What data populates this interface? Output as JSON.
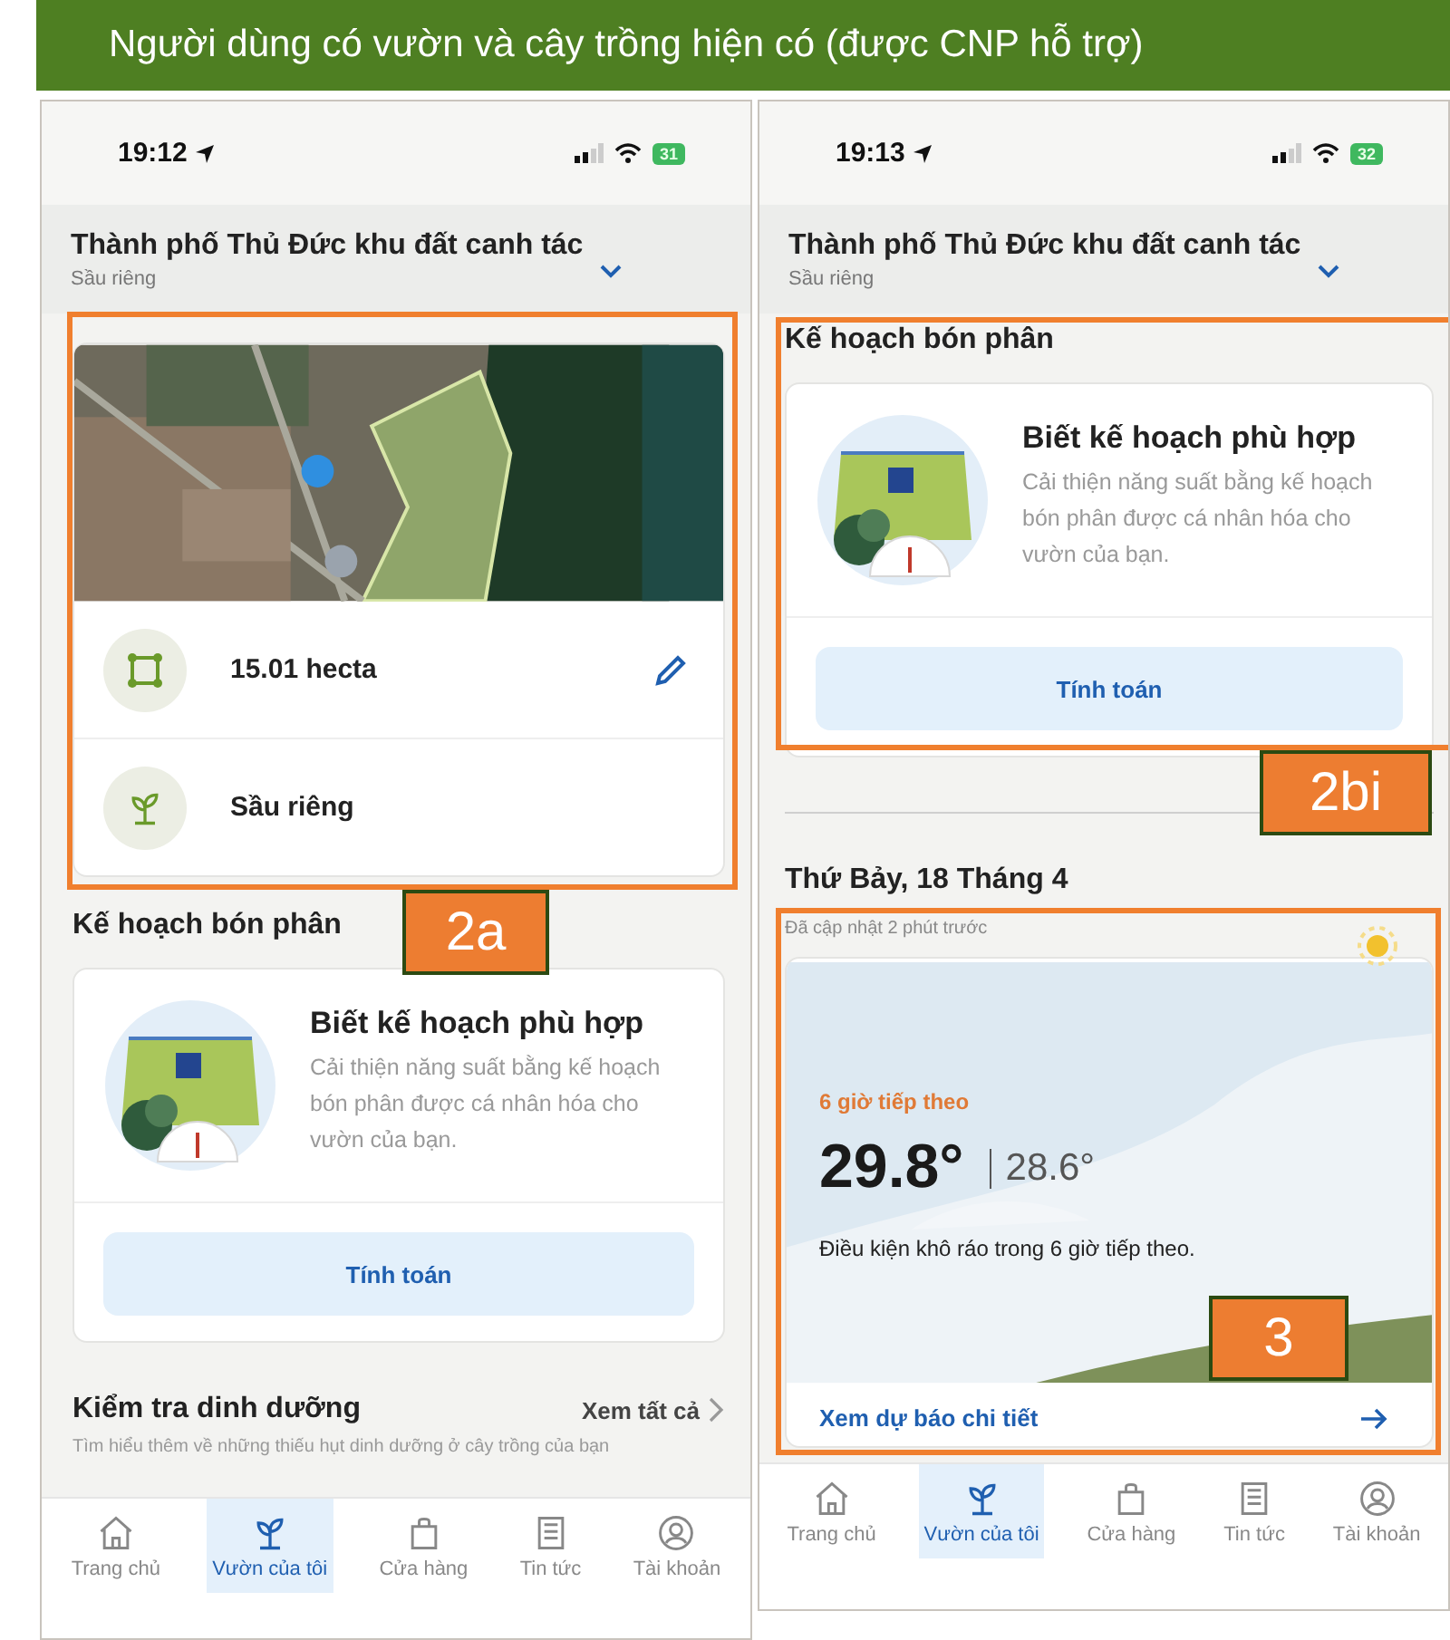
{
  "banner": {
    "title": "Người dùng có vườn và cây trồng hiện có (được CNP hỗ trợ)"
  },
  "screens": [
    {
      "status_bar": {
        "time": "19:12",
        "battery": "31"
      },
      "header": {
        "title": "Thành phố Thủ Đức khu đất canh tác",
        "subtitle": "Sầu riêng"
      },
      "sections": [
        {
          "kind": "farm",
          "annotation": "2a",
          "area": "15.01 hecta",
          "crop": "Sầu riêng"
        },
        {
          "kind": "plan",
          "heading": "Kế hoạch bón phân",
          "card_title": "Biết kế hoạch phù hợp",
          "description": "Cải thiện năng suất bằng kế hoạch bón phân được cá nhân hóa cho vườn của bạn.",
          "button": "Tính toán"
        },
        {
          "kind": "nutrition",
          "heading": "Kiểm tra dinh dưỡng",
          "link": "Xem tất cả",
          "description": "Tìm hiểu thêm về những thiếu hụt dinh dưỡng ở cây trồng của bạn"
        }
      ],
      "tabs": [
        {
          "kind": "home",
          "label": "Trang chủ",
          "selected": false
        },
        {
          "kind": "garden",
          "label": "Vườn của tôi",
          "selected": true
        },
        {
          "kind": "shop",
          "label": "Cửa hàng",
          "selected": false
        },
        {
          "kind": "news",
          "label": "Tin tức",
          "selected": false
        },
        {
          "kind": "account",
          "label": "Tài khoản",
          "selected": false
        }
      ]
    },
    {
      "status_bar": {
        "time": "19:13",
        "battery": "32"
      },
      "header": {
        "title": "Thành phố Thủ Đức khu đất canh tác",
        "subtitle": "Sầu riêng"
      },
      "sections": [
        {
          "kind": "plan",
          "annotation": "2bi",
          "heading": "Kế hoạch bón phân",
          "card_title": "Biết kế hoạch phù hợp",
          "description": "Cải thiện năng suất bằng kế hoạch bón phân được cá nhân hóa cho vườn của bạn.",
          "button": "Tính toán"
        },
        {
          "kind": "weather",
          "annotation": "3",
          "heading": "Thứ Bảy, 18 Tháng 4",
          "updated": "Đã cập nhật 2 phút trước",
          "period": "6 giờ tiếp theo",
          "temperature": "29.8°",
          "secondary_temperature": "28.6°",
          "condition": "Điều kiện khô ráo trong 6 giờ tiếp theo.",
          "link": "Xem dự báo chi tiết"
        }
      ],
      "tabs": [
        {
          "kind": "home",
          "label": "Trang chủ",
          "selected": false
        },
        {
          "kind": "garden",
          "label": "Vườn của tôi",
          "selected": true
        },
        {
          "kind": "shop",
          "label": "Cửa hàng",
          "selected": false
        },
        {
          "kind": "news",
          "label": "Tin tức",
          "selected": false
        },
        {
          "kind": "account",
          "label": "Tài khoản",
          "selected": false
        }
      ]
    }
  ]
}
